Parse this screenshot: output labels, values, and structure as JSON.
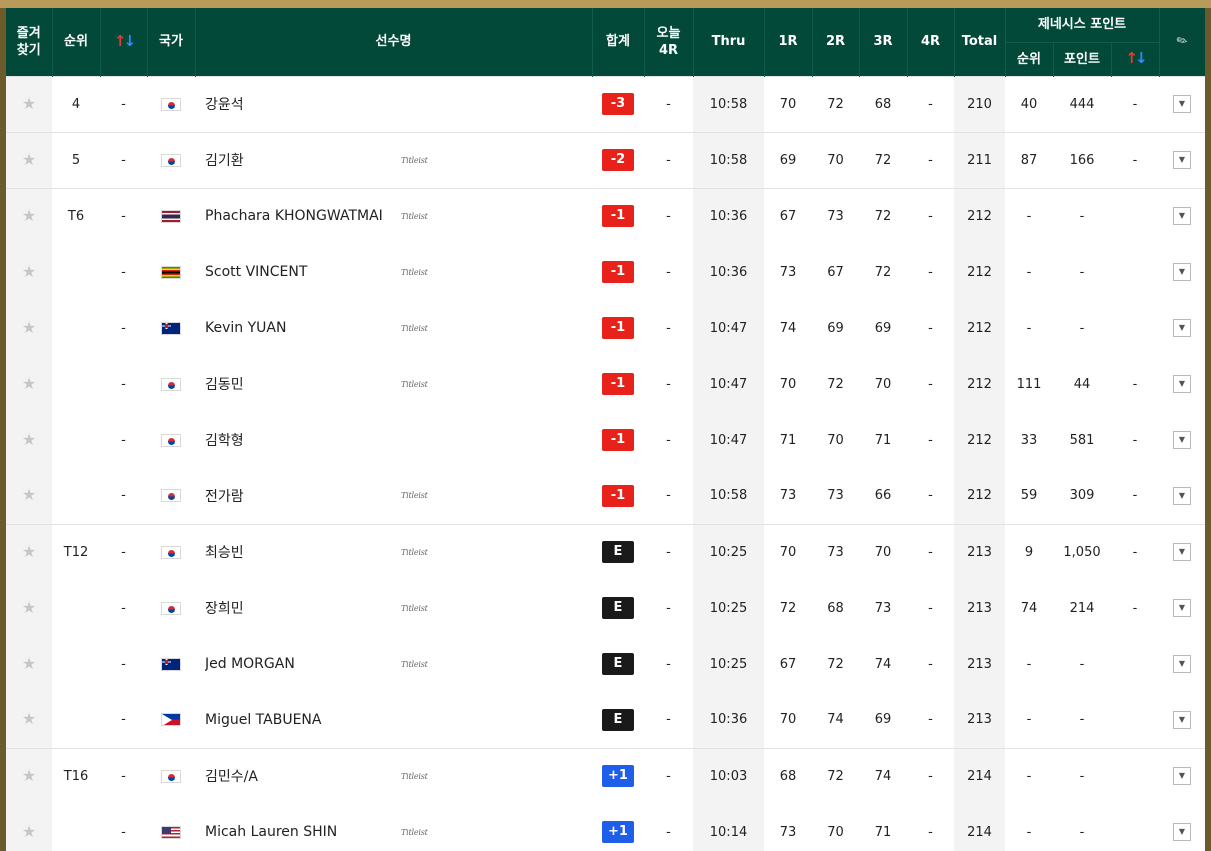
{
  "header": {
    "favorite": "즐겨\n찾기",
    "rank": "순위",
    "country": "국가",
    "player_name": "선수명",
    "total_score": "합계",
    "today": "오늘\n4R",
    "thru": "Thru",
    "r1": "1R",
    "r2": "2R",
    "r3": "3R",
    "r4": "4R",
    "total": "Total",
    "genesis_points": "제네시스 포인트",
    "gp_rank": "순위",
    "gp_points": "포인트",
    "arrow_up": "↑",
    "arrow_down": "↓",
    "edit_icon": "pencil-icon"
  },
  "colors": {
    "header_bg": "#03493a",
    "under_par": "#e8221b",
    "even": "#1a1a1a",
    "over_par": "#1f5ee8"
  },
  "rows": [
    {
      "rank": "4",
      "move": "-",
      "flag": "kr",
      "name": "강윤석",
      "sponsor": "",
      "score": "-3",
      "score_type": "red",
      "today": "-",
      "thru": "10:58",
      "r1": "70",
      "r2": "72",
      "r3": "68",
      "r4": "-",
      "total": "210",
      "gp_rank": "40",
      "gp_points": "444",
      "gp_move": "-",
      "group_start": true
    },
    {
      "rank": "5",
      "move": "-",
      "flag": "kr",
      "name": "김기환",
      "sponsor": "Titleist",
      "score": "-2",
      "score_type": "red",
      "today": "-",
      "thru": "10:58",
      "r1": "69",
      "r2": "70",
      "r3": "72",
      "r4": "-",
      "total": "211",
      "gp_rank": "87",
      "gp_points": "166",
      "gp_move": "-",
      "group_start": true
    },
    {
      "rank": "T6",
      "move": "-",
      "flag": "th",
      "name": "Phachara KHONGWATMAI",
      "sponsor": "Titleist",
      "score": "-1",
      "score_type": "red",
      "today": "-",
      "thru": "10:36",
      "r1": "67",
      "r2": "73",
      "r3": "72",
      "r4": "-",
      "total": "212",
      "gp_rank": "-",
      "gp_points": "-",
      "gp_move": "",
      "group_start": true
    },
    {
      "rank": "",
      "move": "-",
      "flag": "zw",
      "name": "Scott VINCENT",
      "sponsor": "Titleist",
      "score": "-1",
      "score_type": "red",
      "today": "-",
      "thru": "10:36",
      "r1": "73",
      "r2": "67",
      "r3": "72",
      "r4": "-",
      "total": "212",
      "gp_rank": "-",
      "gp_points": "-",
      "gp_move": "",
      "group_start": false
    },
    {
      "rank": "",
      "move": "-",
      "flag": "au",
      "name": "Kevin YUAN",
      "sponsor": "Titleist",
      "score": "-1",
      "score_type": "red",
      "today": "-",
      "thru": "10:47",
      "r1": "74",
      "r2": "69",
      "r3": "69",
      "r4": "-",
      "total": "212",
      "gp_rank": "-",
      "gp_points": "-",
      "gp_move": "",
      "group_start": false
    },
    {
      "rank": "",
      "move": "-",
      "flag": "kr",
      "name": "김동민",
      "sponsor": "Titleist",
      "score": "-1",
      "score_type": "red",
      "today": "-",
      "thru": "10:47",
      "r1": "70",
      "r2": "72",
      "r3": "70",
      "r4": "-",
      "total": "212",
      "gp_rank": "111",
      "gp_points": "44",
      "gp_move": "-",
      "group_start": false
    },
    {
      "rank": "",
      "move": "-",
      "flag": "kr",
      "name": "김학형",
      "sponsor": "",
      "score": "-1",
      "score_type": "red",
      "today": "-",
      "thru": "10:47",
      "r1": "71",
      "r2": "70",
      "r3": "71",
      "r4": "-",
      "total": "212",
      "gp_rank": "33",
      "gp_points": "581",
      "gp_move": "-",
      "group_start": false
    },
    {
      "rank": "",
      "move": "-",
      "flag": "kr",
      "name": "전가람",
      "sponsor": "Titleist",
      "score": "-1",
      "score_type": "red",
      "today": "-",
      "thru": "10:58",
      "r1": "73",
      "r2": "73",
      "r3": "66",
      "r4": "-",
      "total": "212",
      "gp_rank": "59",
      "gp_points": "309",
      "gp_move": "-",
      "group_start": false
    },
    {
      "rank": "T12",
      "move": "-",
      "flag": "kr",
      "name": "최승빈",
      "sponsor": "Titleist",
      "score": "E",
      "score_type": "black",
      "today": "-",
      "thru": "10:25",
      "r1": "70",
      "r2": "73",
      "r3": "70",
      "r4": "-",
      "total": "213",
      "gp_rank": "9",
      "gp_points": "1,050",
      "gp_move": "-",
      "group_start": true
    },
    {
      "rank": "",
      "move": "-",
      "flag": "kr",
      "name": "장희민",
      "sponsor": "Titleist",
      "score": "E",
      "score_type": "black",
      "today": "-",
      "thru": "10:25",
      "r1": "72",
      "r2": "68",
      "r3": "73",
      "r4": "-",
      "total": "213",
      "gp_rank": "74",
      "gp_points": "214",
      "gp_move": "-",
      "group_start": false
    },
    {
      "rank": "",
      "move": "-",
      "flag": "au",
      "name": "Jed MORGAN",
      "sponsor": "Titleist",
      "score": "E",
      "score_type": "black",
      "today": "-",
      "thru": "10:25",
      "r1": "67",
      "r2": "72",
      "r3": "74",
      "r4": "-",
      "total": "213",
      "gp_rank": "-",
      "gp_points": "-",
      "gp_move": "",
      "group_start": false
    },
    {
      "rank": "",
      "move": "-",
      "flag": "ph",
      "name": "Miguel TABUENA",
      "sponsor": "",
      "score": "E",
      "score_type": "black",
      "today": "-",
      "thru": "10:36",
      "r1": "70",
      "r2": "74",
      "r3": "69",
      "r4": "-",
      "total": "213",
      "gp_rank": "-",
      "gp_points": "-",
      "gp_move": "",
      "group_start": false
    },
    {
      "rank": "T16",
      "move": "-",
      "flag": "kr",
      "name": "김민수/A",
      "sponsor": "Titleist",
      "score": "+1",
      "score_type": "blue",
      "today": "-",
      "thru": "10:03",
      "r1": "68",
      "r2": "72",
      "r3": "74",
      "r4": "-",
      "total": "214",
      "gp_rank": "-",
      "gp_points": "-",
      "gp_move": "",
      "group_start": true
    },
    {
      "rank": "",
      "move": "-",
      "flag": "us",
      "name": "Micah Lauren SHIN",
      "sponsor": "Titleist",
      "score": "+1",
      "score_type": "blue",
      "today": "-",
      "thru": "10:14",
      "r1": "73",
      "r2": "70",
      "r3": "71",
      "r4": "-",
      "total": "214",
      "gp_rank": "-",
      "gp_points": "-",
      "gp_move": "",
      "group_start": false
    }
  ]
}
